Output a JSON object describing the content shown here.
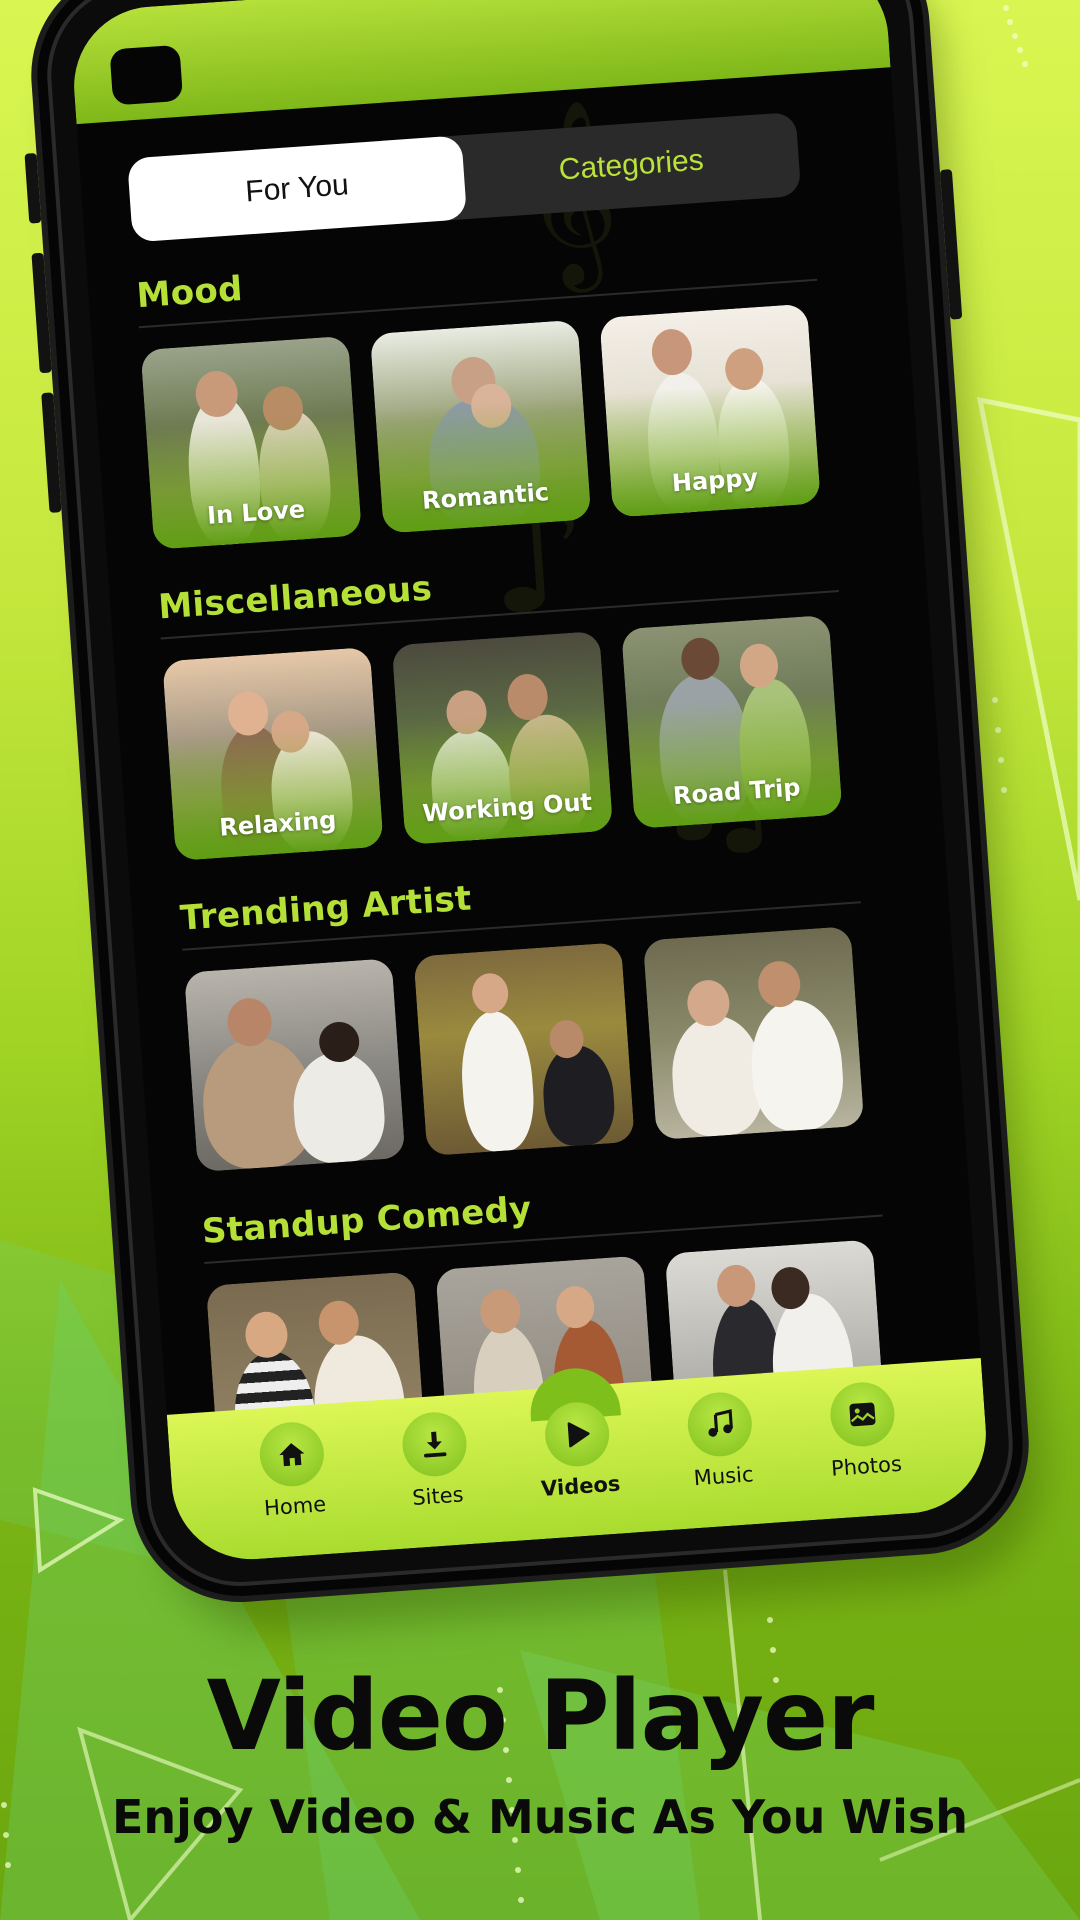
{
  "colors": {
    "accent": "#b5e038",
    "screen_bg": "#050505",
    "tab_inactive_bg": "#2a2a2b",
    "nav_bg": "#c9ec45",
    "headline": "#0a0a0a"
  },
  "tabs": [
    {
      "label": "For You",
      "active": true
    },
    {
      "label": "Categories",
      "active": false
    }
  ],
  "sections": [
    {
      "title": "Mood",
      "cards": [
        {
          "label": "In Love"
        },
        {
          "label": "Romantic"
        },
        {
          "label": "Happy"
        }
      ]
    },
    {
      "title": "Miscellaneous",
      "cards": [
        {
          "label": "Relaxing"
        },
        {
          "label": "Working Out"
        },
        {
          "label": "Road Trip"
        }
      ]
    },
    {
      "title": "Trending Artist",
      "cards": [
        {
          "label": ""
        },
        {
          "label": ""
        },
        {
          "label": ""
        }
      ]
    },
    {
      "title": "Standup Comedy",
      "cards": [
        {
          "label": ""
        },
        {
          "label": ""
        },
        {
          "label": ""
        }
      ]
    }
  ],
  "bottom_nav": [
    {
      "label": "Home",
      "icon": "home-icon",
      "active": false
    },
    {
      "label": "Sites",
      "icon": "download-icon",
      "active": false
    },
    {
      "label": "Videos",
      "icon": "play-icon",
      "active": true
    },
    {
      "label": "Music",
      "icon": "music-note-icon",
      "active": false
    },
    {
      "label": "Photos",
      "icon": "image-icon",
      "active": false
    }
  ],
  "promo": {
    "title": "Video Player",
    "subtitle": "Enjoy Video & Music As You Wish"
  }
}
